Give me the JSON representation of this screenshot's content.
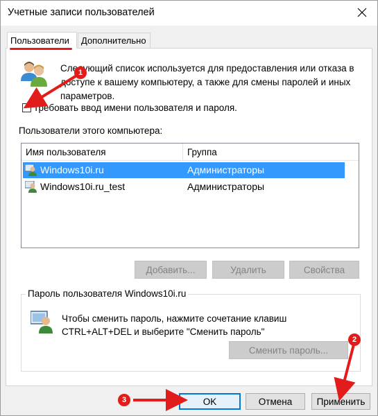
{
  "window": {
    "title": "Учетные записи пользователей",
    "close_icon": "close-icon"
  },
  "tabs": [
    {
      "label": "Пользователи",
      "active": true
    },
    {
      "label": "Дополнительно",
      "active": false
    }
  ],
  "info": {
    "text": "Следующий список используется для предоставления или отказа в доступе к вашему компьютеру, а также для смены паролей и иных параметров."
  },
  "require_login": {
    "label": "Требовать ввод имени пользователя и пароля.",
    "checked": false
  },
  "users_section": {
    "label": "Пользователи этого компьютера:",
    "columns": [
      "Имя пользователя",
      "Группа"
    ],
    "rows": [
      {
        "name": "Windows10i.ru",
        "group": "Администраторы",
        "selected": true
      },
      {
        "name": "Windows10i.ru_test",
        "group": "Администраторы",
        "selected": false
      }
    ],
    "buttons": {
      "add": "Добавить...",
      "delete": "Удалить",
      "properties": "Свойства"
    }
  },
  "password_group": {
    "title": "Пароль пользователя Windows10i.ru",
    "text": "Чтобы сменить пароль, нажмите сочетание клавиш CTRL+ALT+DEL и выберите \"Сменить пароль\"",
    "change_button": "Сменить пароль..."
  },
  "footer": {
    "ok": "OK",
    "cancel": "Отмена",
    "apply": "Применить"
  },
  "annotations": {
    "markers": [
      "1",
      "2",
      "3"
    ],
    "color": "#e21b1b"
  },
  "colors": {
    "selection": "#3399ff",
    "accent": "#0078d7"
  }
}
